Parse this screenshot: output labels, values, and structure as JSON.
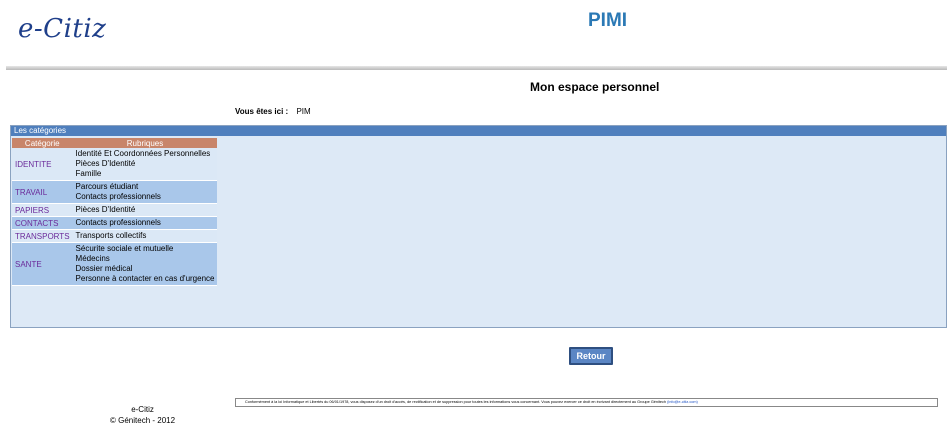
{
  "header": {
    "logo_text": "e-Citiz",
    "app_title": "PIMI"
  },
  "page": {
    "title": "Mon espace personnel"
  },
  "breadcrumb": {
    "label": "Vous êtes ici :",
    "value": "PIM"
  },
  "categories_panel": {
    "title": "Les catégories",
    "columns": [
      "Catégorie",
      "Rubriques"
    ],
    "rows": [
      {
        "category": "IDENTITE",
        "rubriques": [
          "Identité Et Coordonnées Personnelles",
          "Pièces D'Identité",
          "Famille"
        ]
      },
      {
        "category": "TRAVAIL",
        "rubriques": [
          "Parcours étudiant",
          "Contacts professionnels"
        ]
      },
      {
        "category": "PAPIERS",
        "rubriques": [
          "Pièces D'Identité"
        ]
      },
      {
        "category": "CONTACTS",
        "rubriques": [
          "Contacts professionnels"
        ]
      },
      {
        "category": "TRANSPORTS",
        "rubriques": [
          "Transports collectifs"
        ]
      },
      {
        "category": "SANTE",
        "rubriques": [
          "Sécurite sociale et mutuelle",
          "Médecins",
          "Dossier médical",
          "Personne à contacter en cas d'urgence"
        ]
      }
    ]
  },
  "actions": {
    "retour_label": "Retour"
  },
  "footer": {
    "notice_text": "Conformément à la loi Informatique et Libertés du 06/01/1978, vous disposez d'un droit d'accès, de rectification et de suppression pour toutes les informations vous concernant. Vous pouvez exercer ce droit en écrivant directement au Groupe Génitech",
    "notice_link": "(info@e-citiz.com)",
    "brand": "e-Citiz",
    "copyright": "© Génitech - 2012"
  }
}
